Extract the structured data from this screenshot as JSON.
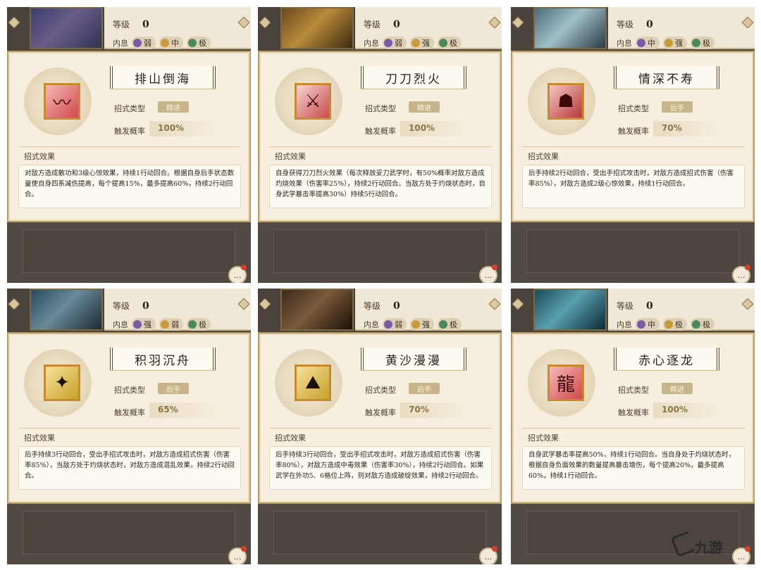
{
  "common": {
    "level_label": "等级",
    "level_value": "0",
    "affinity_label": "内息",
    "type_label": "招式类型",
    "rate_label": "触发概率",
    "effect_label": "招式效果",
    "chat_icon": "…"
  },
  "panels": [
    {
      "affinities": [
        {
          "label": "弱",
          "dot": "purple"
        },
        {
          "label": "中",
          "dot": "gold"
        },
        {
          "label": "极",
          "dot": "green"
        }
      ],
      "skill_name": "排山倒海",
      "skill_icon": "claw-slash-icon",
      "skill_glyph": "〰",
      "type": "精进",
      "rate": "100%",
      "effect": "对敌方造成散功和3级心惊效果，持续1行动回合。根据自身后手状态数量使自身四系减伤提高，每个提高15%，最多提高60%，持续2行动回合。"
    },
    {
      "affinities": [
        {
          "label": "弱",
          "dot": "purple"
        },
        {
          "label": "强",
          "dot": "gold"
        },
        {
          "label": "极",
          "dot": "green"
        }
      ],
      "skill_name": "刀刀烈火",
      "skill_icon": "blade-fire-icon",
      "skill_glyph": "⚔",
      "type": "精进",
      "rate": "100%",
      "effect": "自身获得刀刀烈火效果（每次释放妥刀武学时，有50%概率对敌方造成灼烧效果（伤害率25%），持续2行动回合。当敌方处于灼烧状态时，自身武学暴击率提高30%）持续5行动回合。"
    },
    {
      "affinities": [
        {
          "label": "中",
          "dot": "purple"
        },
        {
          "label": "强",
          "dot": "gold"
        },
        {
          "label": "极",
          "dot": "green"
        }
      ],
      "skill_name": "情深不寿",
      "skill_icon": "figure-icon",
      "skill_glyph": "☗",
      "type": "后手",
      "rate": "70%",
      "effect": "后手持续2行动回合，受出手招式攻击时，对敌方造成招式伤害（伤害率85%），对敌方造成2级心惊效果，持续1行动回合。"
    },
    {
      "affinities": [
        {
          "label": "强",
          "dot": "purple"
        },
        {
          "label": "弱",
          "dot": "gold"
        },
        {
          "label": "极",
          "dot": "green"
        }
      ],
      "skill_name": "积羽沉舟",
      "skill_icon": "feather-icon",
      "skill_glyph": "✦",
      "type": "后手",
      "rate": "65%",
      "effect": "后手持续3行动回合，受出手招式攻击时，对敌方造成招式伤害（伤害率85%），当敌方处于灼烧状态时，对敌方造成混乱效果，持续2行动回合。"
    },
    {
      "affinities": [
        {
          "label": "弱",
          "dot": "purple"
        },
        {
          "label": "强",
          "dot": "gold"
        },
        {
          "label": "极",
          "dot": "green"
        }
      ],
      "skill_name": "黄沙漫漫",
      "skill_icon": "mountain-icon",
      "skill_glyph": "⛰",
      "type": "后手",
      "rate": "70%",
      "effect": "后手持续3行动回合，受出手招式攻击时，对敌方造成招式伤害（伤害率80%），对敌方造成中毒效果（伤害率30%），持续2行动回合。如果武学在外功5、6格位上阵，则对敌方造成破绽效果，持续2行动回合。"
    },
    {
      "affinities": [
        {
          "label": "中",
          "dot": "purple"
        },
        {
          "label": "极",
          "dot": "gold"
        },
        {
          "label": "极",
          "dot": "green"
        }
      ],
      "skill_name": "赤心逐龙",
      "skill_icon": "dragon-icon",
      "skill_glyph": "龍",
      "type": "精进",
      "rate": "100%",
      "effect": "自身武学暴击率提高50%，持续1行动回合。当自身处于灼烧状态时，根据自身负面效果的数量提高暴击增伤，每个提高20%，最多提高60%，持续1行动回合。"
    }
  ],
  "watermark": {
    "text": "九游",
    "icon": "jiuyou-logo-icon"
  }
}
